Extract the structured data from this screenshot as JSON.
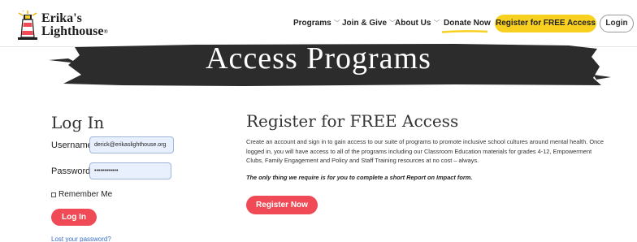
{
  "header": {
    "logo": {
      "line1": "Erika's",
      "line2": "Lighthouse",
      "reg_mark": "®"
    },
    "nav": [
      {
        "label": "Programs",
        "has_dropdown": true
      },
      {
        "label": "Join & Give",
        "has_dropdown": true
      },
      {
        "label": "About Us",
        "has_dropdown": true
      },
      {
        "label": "Donate Now",
        "has_dropdown": false
      }
    ],
    "chevron_glyph": "﹀",
    "register_button": "Register for FREE Access",
    "login_button": "Login",
    "colors": {
      "accent_yellow": "#f7d020",
      "brand_red": "#ef4a56"
    }
  },
  "banner": {
    "title": "Access Programs"
  },
  "login": {
    "heading": "Log In",
    "username_label": "Username",
    "username_value": "derick@erikaslighthouse.org",
    "password_label": "Password",
    "password_value": "••••••••••••",
    "remember_label": "Remember Me",
    "submit_label": "Log In",
    "lost_password": "Lost your password?"
  },
  "register": {
    "heading": "Register for FREE Access",
    "description": "Create an account and sign in to gain access to our suite of programs to promote inclusive school cultures around mental health. Once logged in, you will have access to all of the programs including our Classroom Education materials for grades 4-12, Empowerment Clubs, Family Engagement and Policy and Staff Training resources at no cost – always.",
    "note": "The only thing we require is for you to complete a short Report on Impact form.",
    "submit_label": "Register Now"
  }
}
